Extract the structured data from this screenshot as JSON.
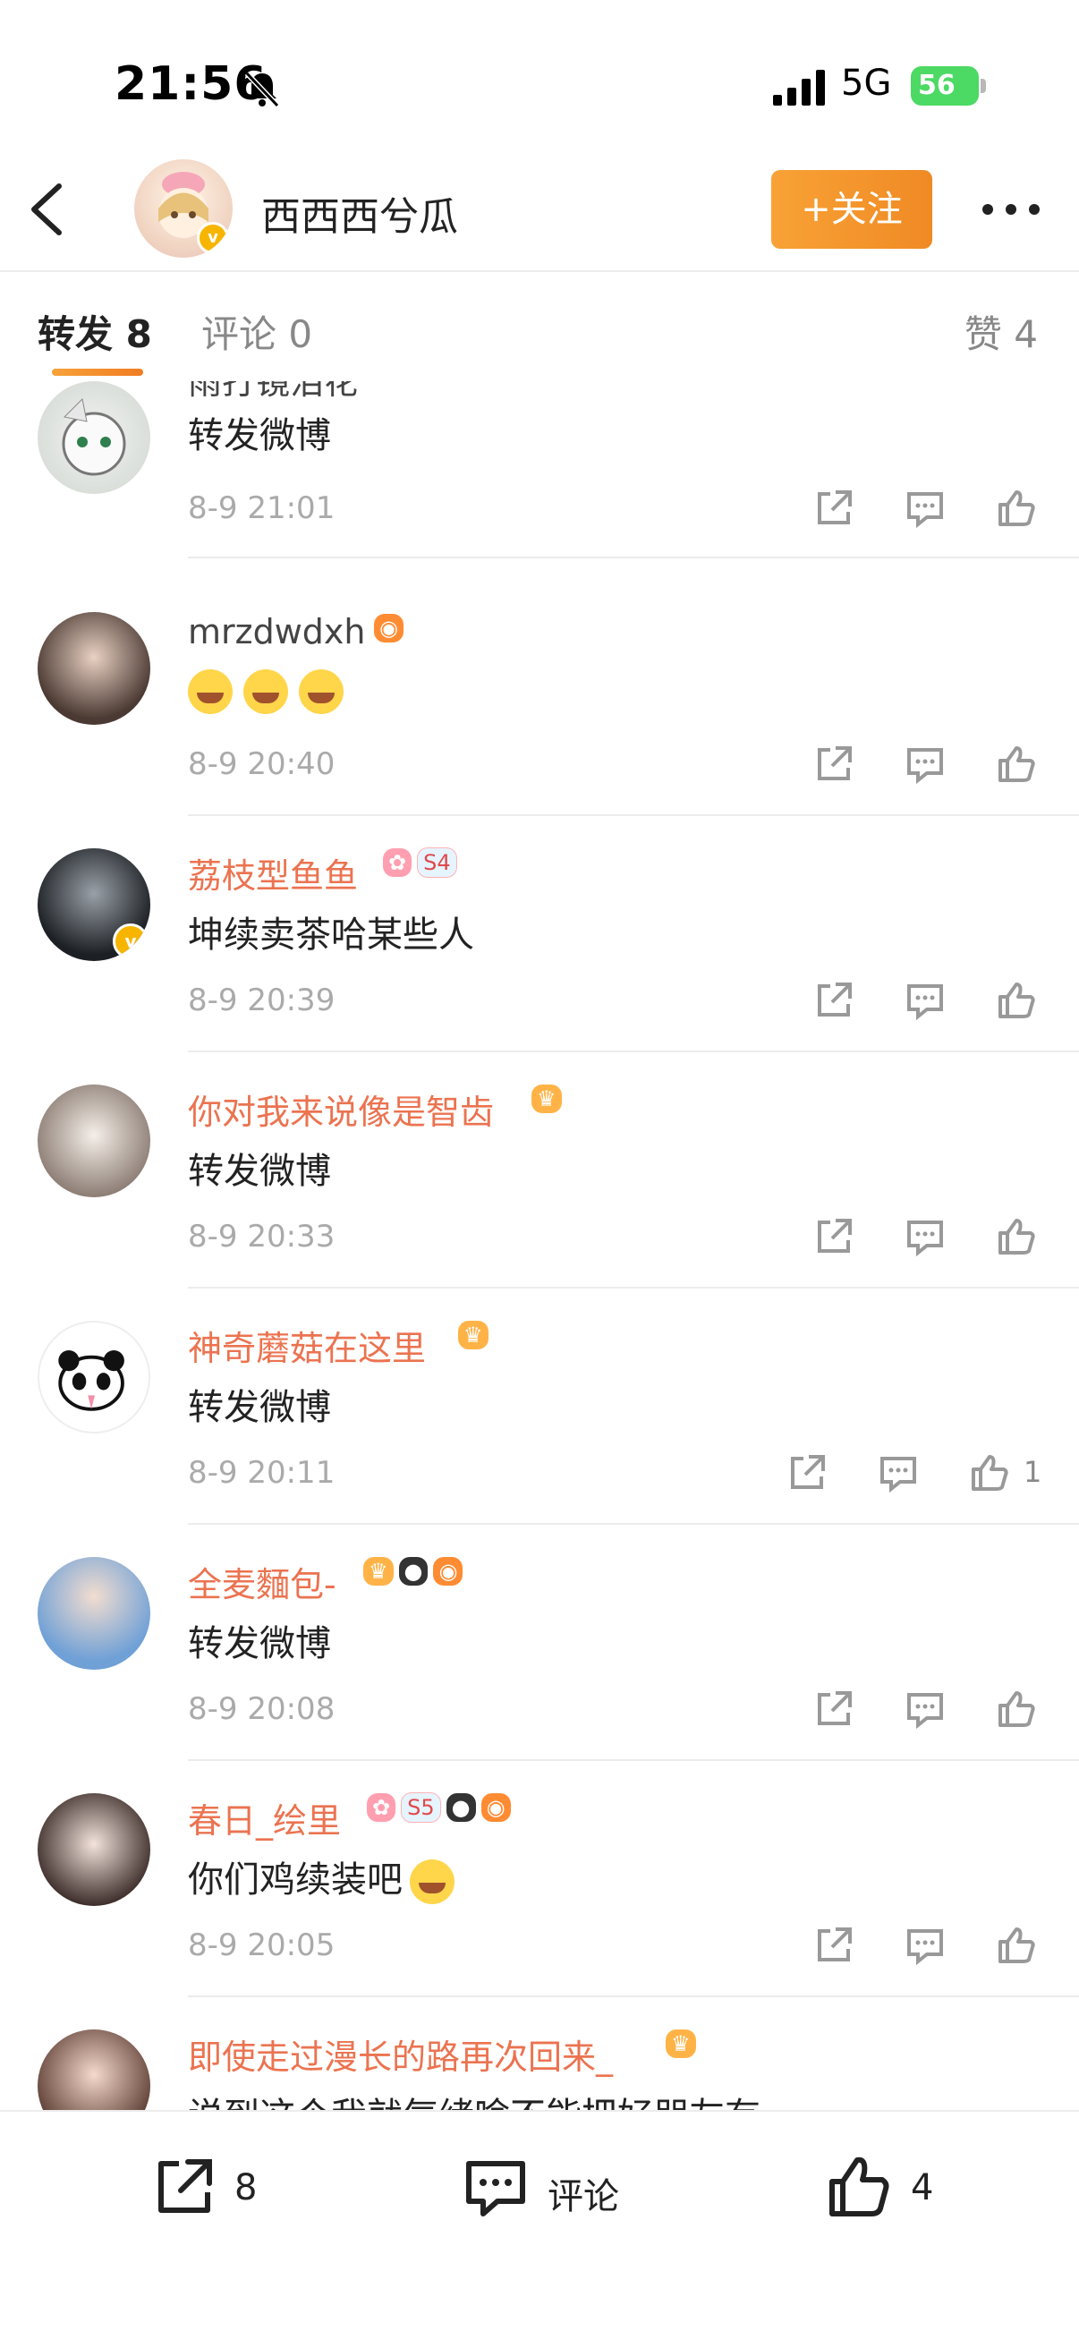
{
  "status_bar": {
    "time": "21:56",
    "network": "5G",
    "battery": "56"
  },
  "header": {
    "username": "西西西兮瓜",
    "follow_label": "+关注"
  },
  "tabs": {
    "repost": "转发 8",
    "comment": "评论 0",
    "like": "赞 4"
  },
  "reposts": [
    {
      "username": "雨打镜泪花",
      "text": "转发微博",
      "time": "8-9 21:01",
      "likes": ""
    },
    {
      "username": "mrzdwdxh",
      "text": "",
      "time": "8-9 20:40",
      "likes": ""
    },
    {
      "username": "荔枝型鱼鱼",
      "text": "坤续卖茶哈某些人",
      "time": "8-9 20:39",
      "likes": "",
      "level": "S4"
    },
    {
      "username": "你对我来说像是智齿",
      "text": "转发微博",
      "time": "8-9 20:33",
      "likes": ""
    },
    {
      "username": "神奇蘑菇在这里",
      "text": "转发微博",
      "time": "8-9 20:11",
      "likes": "1"
    },
    {
      "username": "全麦麵包-",
      "text": "转发微博",
      "time": "8-9 20:08",
      "likes": ""
    },
    {
      "username": "春日_绘里",
      "text": "你们鸡续装吧",
      "time": "8-9 20:05",
      "likes": "",
      "level": "S5"
    },
    {
      "username": "即使走过漫长的路再次回来_",
      "text": "说到这个我就气绪啥不能把好朋友有",
      "time": "",
      "likes": ""
    }
  ],
  "bottom_bar": {
    "repost_count": "8",
    "comment_label": "评论",
    "like_count": "4"
  },
  "colors": {
    "accent": "#f08a24",
    "username_orange": "#eb7350",
    "verified": "#f7b500"
  },
  "icons": [
    "back-arrow-icon",
    "more-dots-icon",
    "share-icon",
    "comment-icon",
    "like-icon",
    "bell-muted-icon",
    "signal-icon"
  ]
}
